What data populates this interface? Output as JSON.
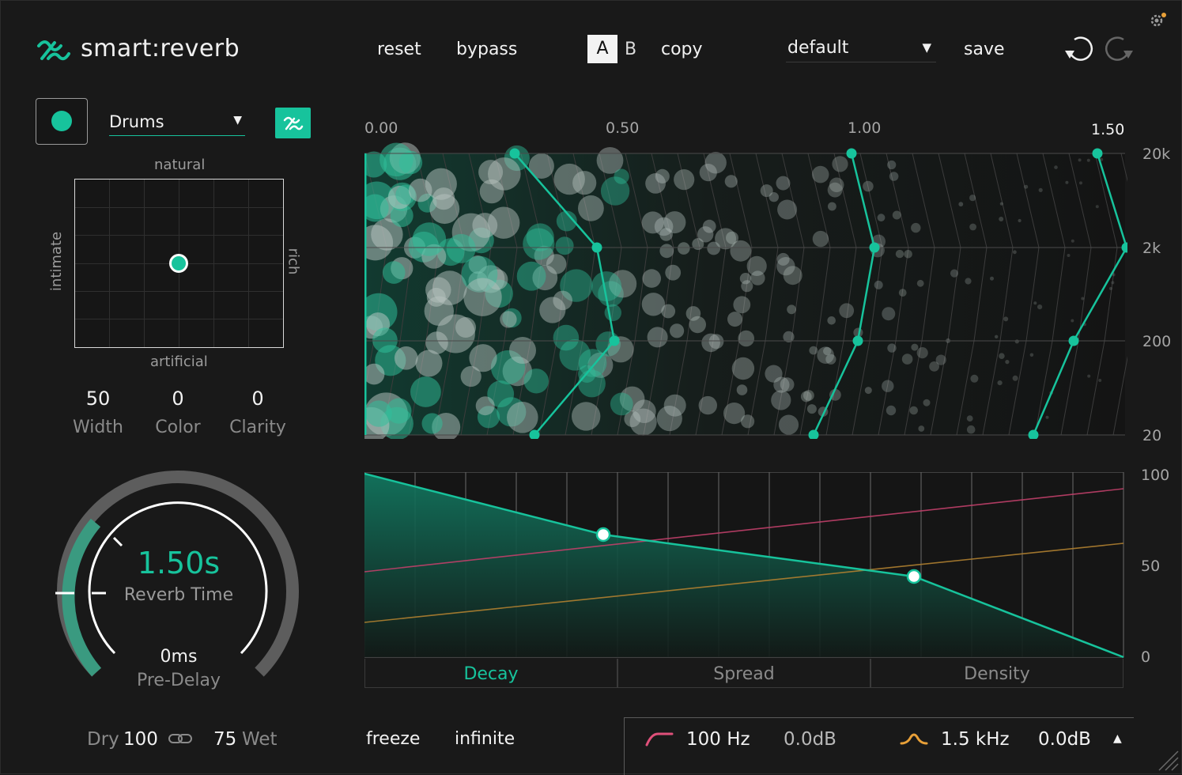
{
  "header": {
    "title": "smart:reverb",
    "reset": "reset",
    "bypass": "bypass",
    "ab_a": "A",
    "ab_b": "B",
    "copy": "copy",
    "preset": "default",
    "save": "save",
    "undo_icon": "undo-icon",
    "redo_icon": "redo-icon",
    "settings_icon": "gear-icon"
  },
  "left": {
    "profile": "Drums",
    "pad_top": "natural",
    "pad_bottom": "artificial",
    "pad_left": "intimate",
    "pad_right": "rich",
    "params": [
      {
        "value": "50",
        "name": "Width"
      },
      {
        "value": "0",
        "name": "Color"
      },
      {
        "value": "0",
        "name": "Clarity"
      }
    ],
    "reverb_time": "1.50s",
    "reverb_time_label": "Reverb Time",
    "predelay": "0ms",
    "predelay_label": "Pre-Delay",
    "dry_label": "Dry",
    "dry_value": "100",
    "wet_value": "75",
    "wet_label": "Wet"
  },
  "top_graph": {
    "x_labels": [
      "0.00",
      "0.50",
      "1.00",
      "1.50"
    ],
    "y_labels": [
      "20k",
      "2k",
      "200",
      "20"
    ]
  },
  "bottom_graph": {
    "y_labels": [
      "100",
      "50",
      "0"
    ],
    "tabs": [
      "Decay",
      "Spread",
      "Density"
    ],
    "active_tab": "Decay"
  },
  "footer": {
    "freeze": "freeze",
    "infinite": "infinite",
    "low_freq": "100 Hz",
    "low_gain": "0.0dB",
    "high_freq": "1.5 kHz",
    "high_gain": "0.0dB"
  },
  "colors": {
    "accent": "#17c39c",
    "low_shelf": "#e0507a",
    "high_shelf": "#e8a038",
    "background": "#191919"
  }
}
